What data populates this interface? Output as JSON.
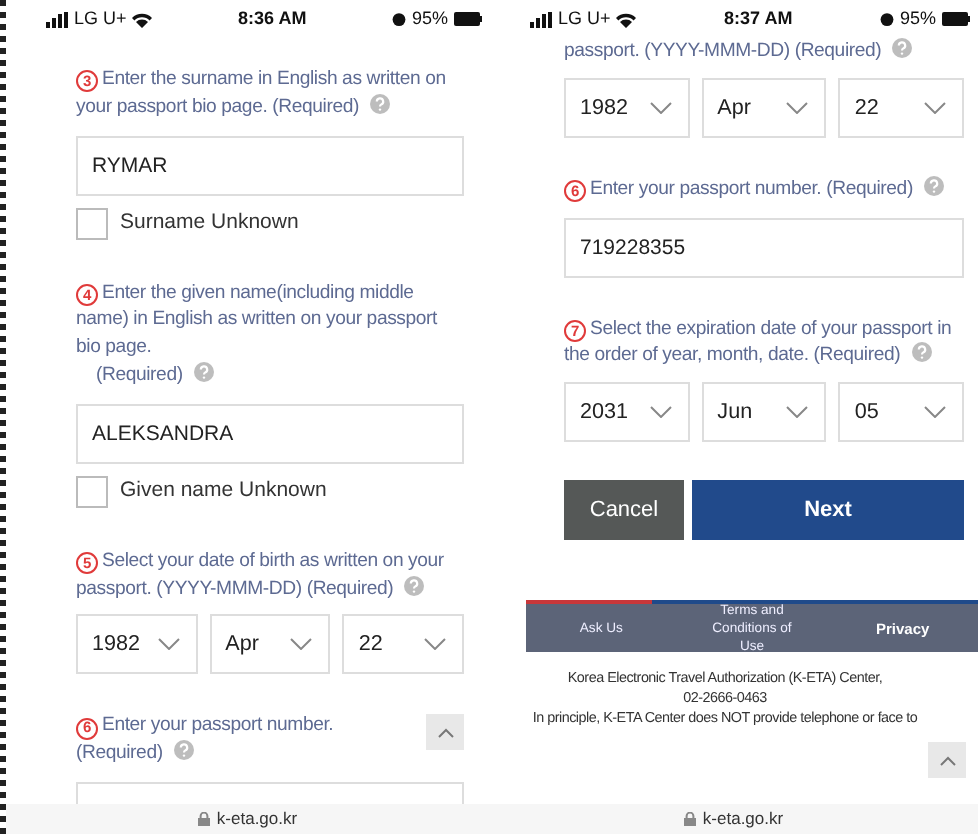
{
  "screens": [
    {
      "status_bar": {
        "carrier": "LG U+",
        "time": "8:36 AM",
        "battery": "95%"
      },
      "items": [
        {
          "kind": "question",
          "number": "3",
          "text": "Enter the surname in English as written on your passport bio page. (Required)"
        },
        {
          "kind": "text_input",
          "value": "RYMAR"
        },
        {
          "kind": "checkbox",
          "label": "Surname Unknown",
          "checked": false
        },
        {
          "kind": "question",
          "number": "4",
          "text": "Enter the given name(including middle name) in English as written on your passport bio page.",
          "extra": "(Required)"
        },
        {
          "kind": "text_input",
          "value": "ALEKSANDRA"
        },
        {
          "kind": "checkbox",
          "label": "Given name Unknown",
          "checked": false
        },
        {
          "kind": "question",
          "number": "5",
          "text": "Select your date of birth as written on your passport. (YYYY-MMM-DD) (Required)"
        },
        {
          "kind": "date_select",
          "values": [
            "1982",
            "Apr",
            "22"
          ]
        },
        {
          "kind": "question",
          "number": "6",
          "text": "Enter your passport number. (Required)"
        },
        {
          "kind": "text_input"
        }
      ],
      "url": "k-eta.go.kr"
    },
    {
      "status_bar": {
        "carrier": "LG U+",
        "time": "8:37 AM",
        "battery": "95%"
      },
      "items": [
        {
          "kind": "question",
          "text": "passport. (YYYY-MMM-DD) (Required)"
        },
        {
          "kind": "date_select",
          "values": [
            "1982",
            "Apr",
            "22"
          ]
        },
        {
          "kind": "question",
          "number": "6",
          "text": "Enter your passport number. (Required)"
        },
        {
          "kind": "text_input",
          "value": "719228355"
        },
        {
          "kind": "question",
          "number": "7",
          "text": "Select the expiration date of your passport in the order of year, month, date. (Required)"
        },
        {
          "kind": "date_select",
          "values": [
            "2031",
            "Jun",
            "05"
          ]
        },
        {
          "kind": "buttons",
          "buttons": [
            {
              "label": "Cancel",
              "kind": "secondary"
            },
            {
              "label": "Next",
              "kind": "primary"
            }
          ]
        },
        {
          "kind": "footer_nav",
          "links": [
            "Ask Us",
            "Terms and Conditions of Use",
            "Privacy"
          ]
        },
        {
          "kind": "footer_text",
          "lines": [
            "Korea Electronic Travel Authorization (K-ETA) Center,",
            "02-2666-0463",
            "In principle, K-ETA Center does NOT provide telephone or face to"
          ]
        }
      ],
      "url": "k-eta.go.kr"
    }
  ]
}
